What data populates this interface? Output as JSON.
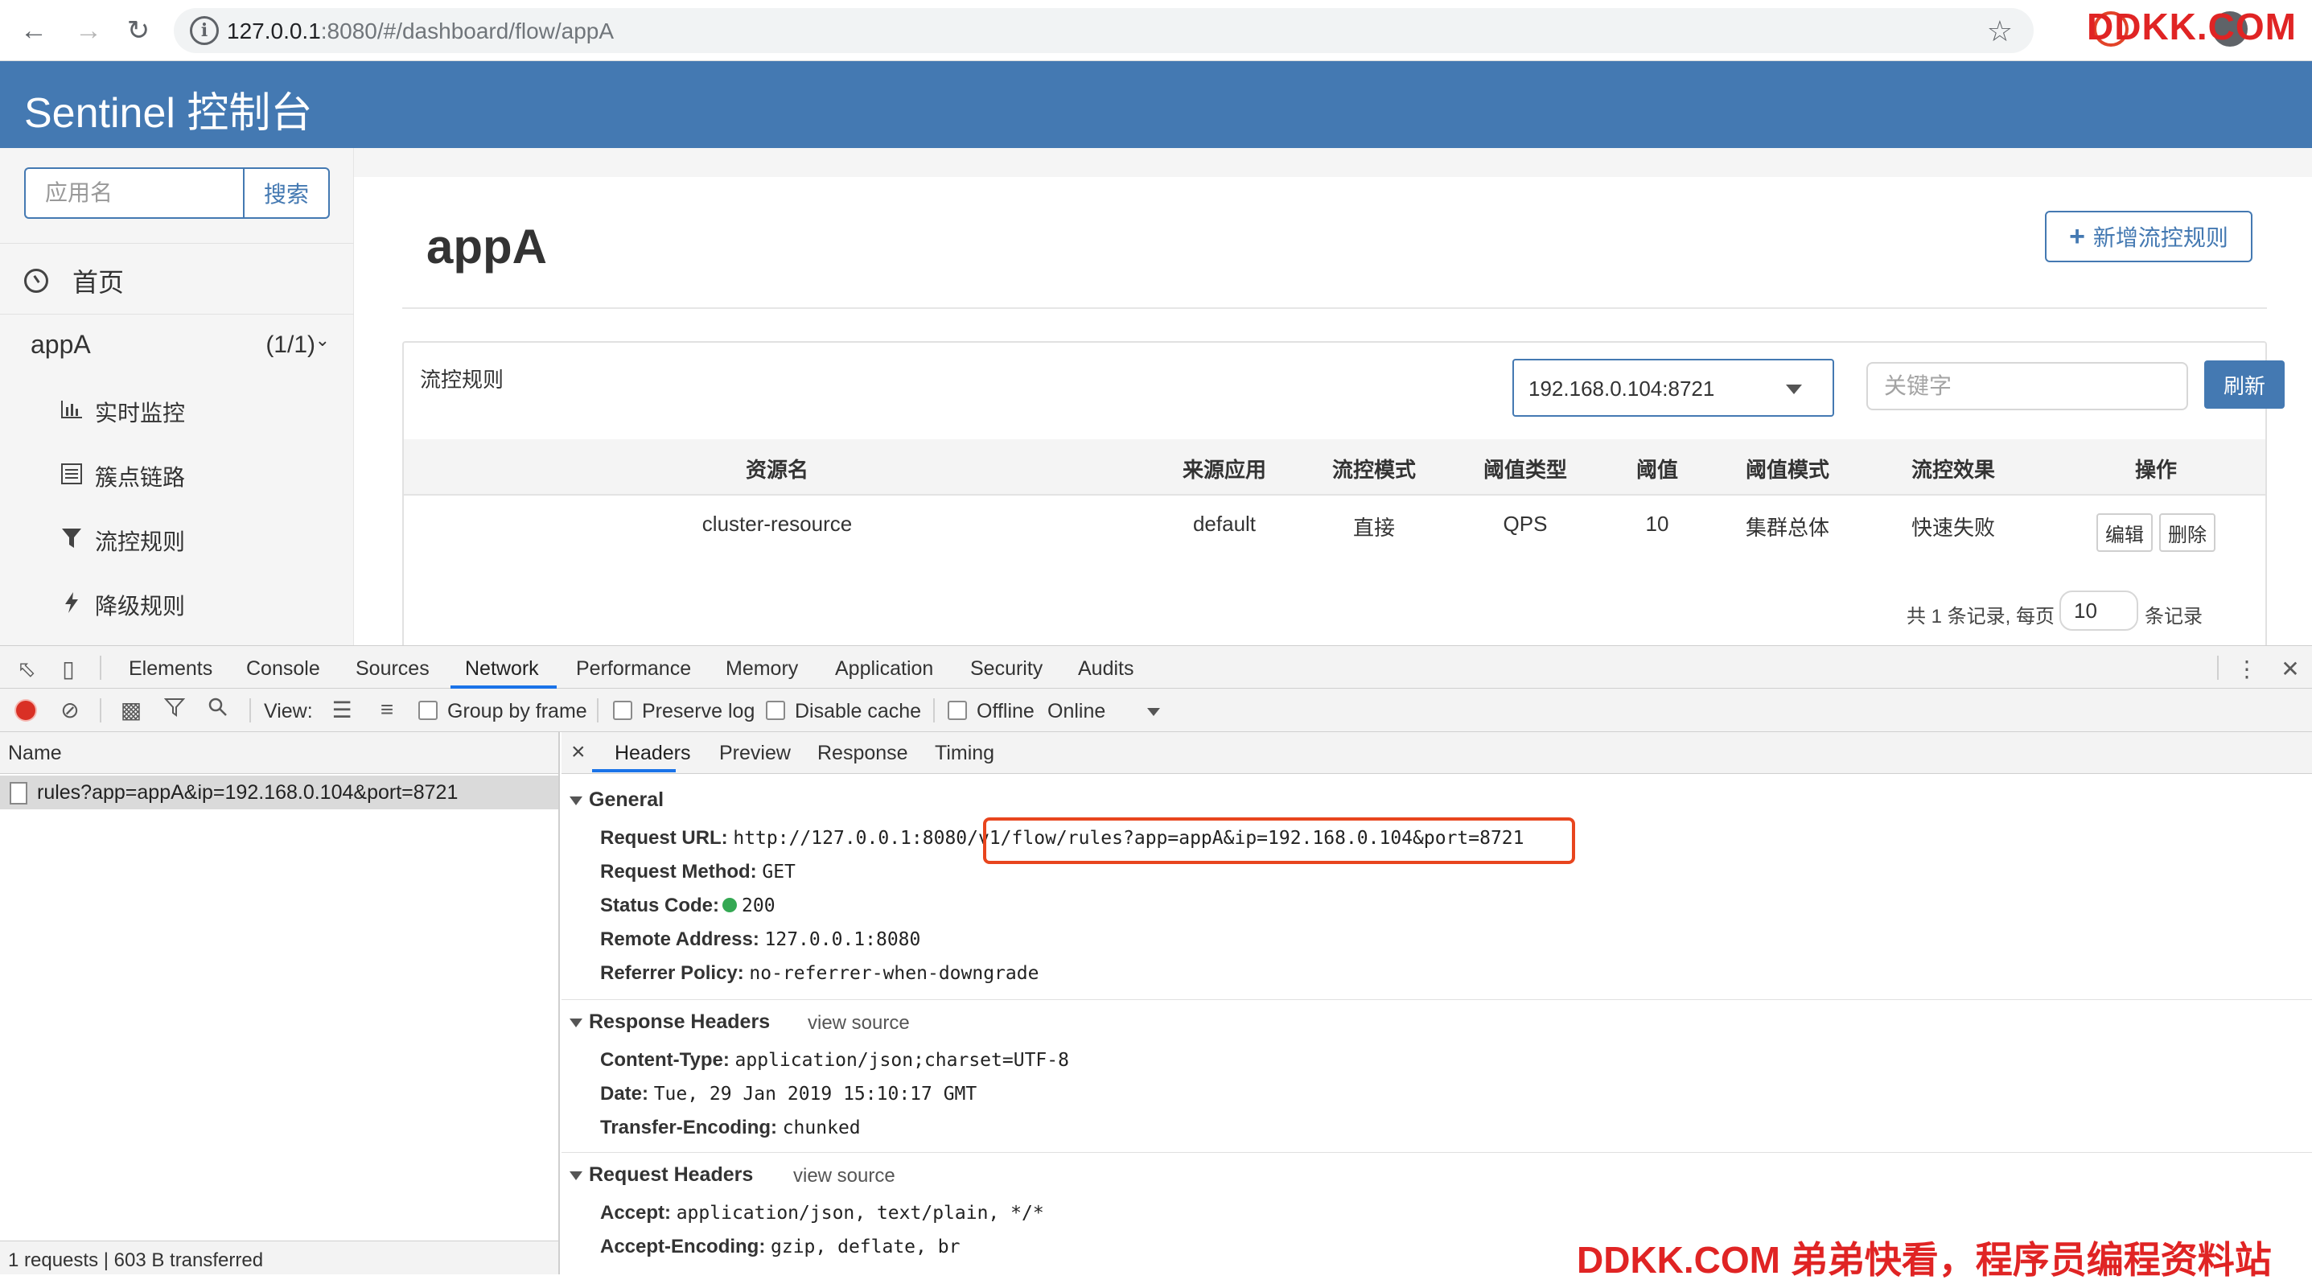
{
  "browser": {
    "url_host": "127.0.0.1",
    "url_rest": ":8080/#/dashboard/flow/appA",
    "watermark": "DDKK.COM"
  },
  "header": {
    "title": "Sentinel 控制台"
  },
  "sidebar": {
    "search_placeholder": "应用名",
    "search_button": "搜索",
    "home_label": "首页",
    "app_name": "appA",
    "app_count": "(1/1)",
    "items": [
      {
        "label": "实时监控",
        "icon": "bar-chart-icon"
      },
      {
        "label": "簇点链路",
        "icon": "list-icon"
      },
      {
        "label": "流控规则",
        "icon": "filter-icon"
      },
      {
        "label": "降级规则",
        "icon": "bolt-icon"
      }
    ]
  },
  "main": {
    "title": "appA",
    "add_button": "新增流控规则",
    "panel_title": "流控规则",
    "machine_select": "192.168.0.104:8721",
    "keyword_placeholder": "关键字",
    "refresh_button": "刷新",
    "columns": [
      "资源名",
      "来源应用",
      "流控模式",
      "阈值类型",
      "阈值",
      "阈值模式",
      "流控效果",
      "操作"
    ],
    "rows": [
      {
        "resource": "cluster-resource",
        "limit_app": "default",
        "mode": "直接",
        "grade": "QPS",
        "count": "10",
        "threshold_mode": "集群总体",
        "effect": "快速失败",
        "edit": "编辑",
        "delete": "删除"
      }
    ],
    "pager": {
      "prefix": "共 1 条记录, 每页",
      "page_size": "10",
      "suffix": "条记录"
    }
  },
  "devtools": {
    "tabs": [
      "Elements",
      "Console",
      "Sources",
      "Network",
      "Performance",
      "Memory",
      "Application",
      "Security",
      "Audits"
    ],
    "active_tab": "Network",
    "toolbar": {
      "view_label": "View:",
      "group_by_frame": "Group by frame",
      "preserve_log": "Preserve log",
      "disable_cache": "Disable cache",
      "offline": "Offline",
      "throttle": "Online"
    },
    "list_header": "Name",
    "request_name": "rules?app=appA&ip=192.168.0.104&port=8721",
    "status_bar": "1 requests | 603 B transferred",
    "detail_tabs": [
      "Headers",
      "Preview",
      "Response",
      "Timing"
    ],
    "general": {
      "title": "General",
      "request_url_label": "Request URL:",
      "request_url_base": "http://127.0.0.1:8080",
      "request_url_path": "/v1/flow/rules?app=appA&ip=192.168.0.104&port=8721",
      "request_method_label": "Request Method:",
      "request_method": "GET",
      "status_code_label": "Status Code:",
      "status_code": "200",
      "remote_address_label": "Remote Address:",
      "remote_address": "127.0.0.1:8080",
      "referrer_policy_label": "Referrer Policy:",
      "referrer_policy": "no-referrer-when-downgrade"
    },
    "response_headers": {
      "title": "Response Headers",
      "view_source": "view source",
      "content_type_label": "Content-Type:",
      "content_type": "application/json;charset=UTF-8",
      "date_label": "Date:",
      "date": "Tue, 29 Jan 2019 15:10:17 GMT",
      "transfer_encoding_label": "Transfer-Encoding:",
      "transfer_encoding": "chunked"
    },
    "request_headers": {
      "title": "Request Headers",
      "view_source": "view source",
      "accept_label": "Accept:",
      "accept": "application/json, text/plain, */*",
      "accept_encoding_label": "Accept-Encoding:",
      "accept_encoding": "gzip, deflate, br"
    },
    "highlight_color": "#e8451e"
  },
  "footer_watermark": "DDKK.COM 弟弟快看，程序员编程资料站"
}
